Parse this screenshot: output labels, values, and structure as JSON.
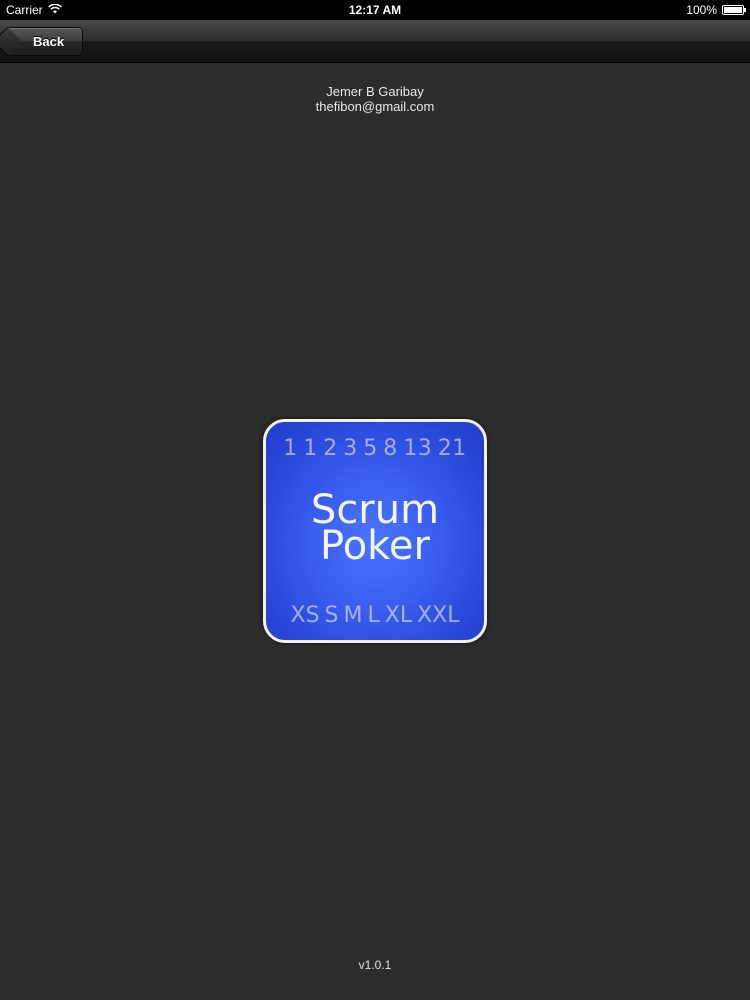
{
  "status_bar": {
    "carrier": "Carrier",
    "time": "12:17 AM",
    "battery": "100%"
  },
  "nav": {
    "back_label": "Back"
  },
  "author": {
    "name": "Jemer B Garibay",
    "email": "thefibon@gmail.com"
  },
  "icon": {
    "top_numbers": "1 1 2 3 5 8 13 21",
    "title_line1": "Scrum",
    "title_line2": "Poker",
    "bottom_sizes": "XS S M L XL XXL"
  },
  "version": "v1.0.1",
  "colors": {
    "background": "#2b2b2b",
    "icon_blue": "#3a5ef0",
    "icon_border": "#f2f2f2"
  }
}
